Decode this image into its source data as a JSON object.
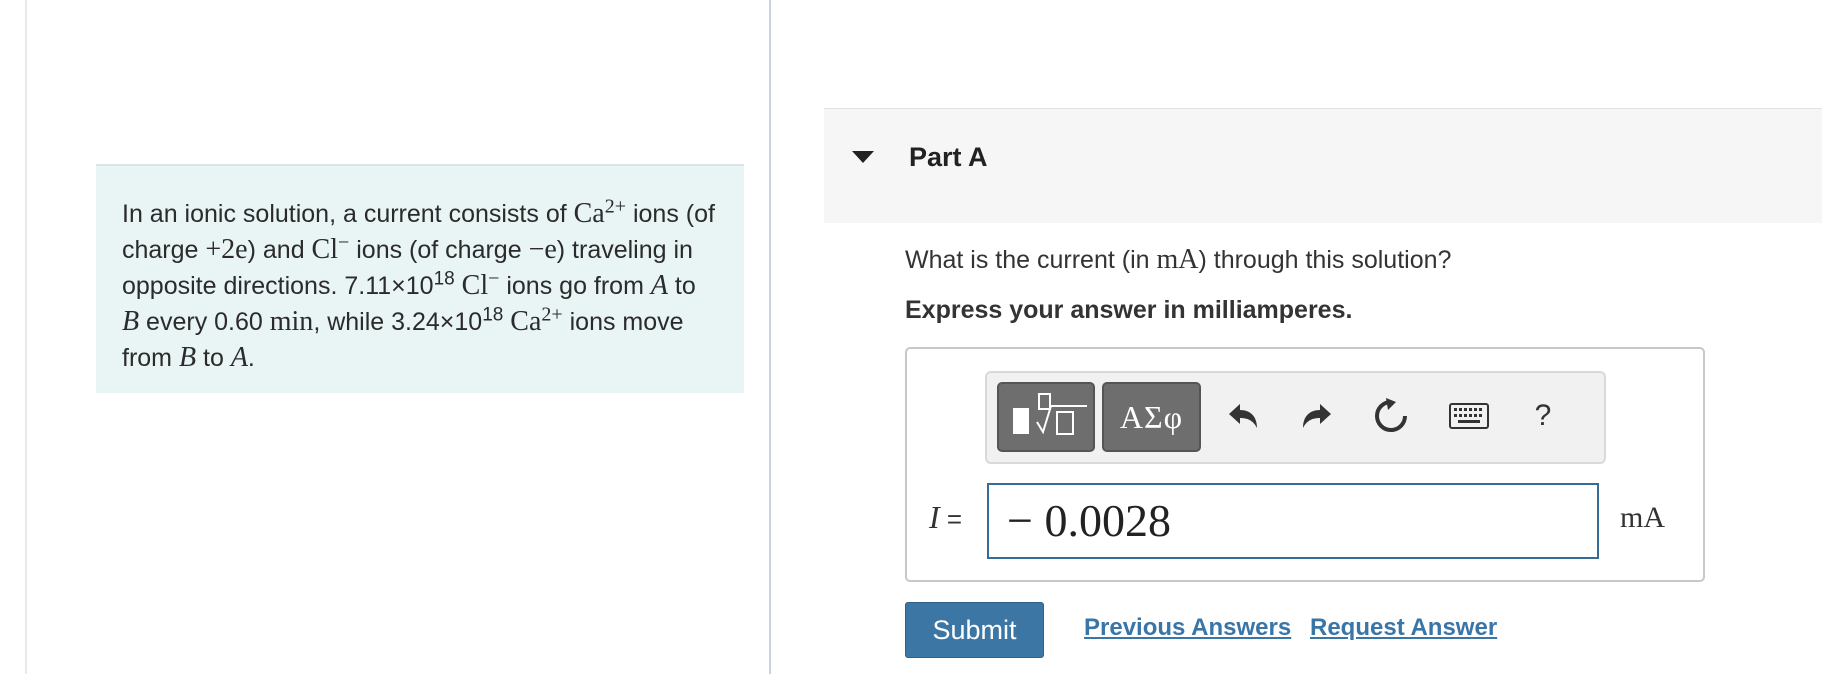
{
  "problem": {
    "t1": "In an ionic solution, a current consists of ",
    "ca": "Ca",
    "ca_sup": "2+",
    "t2": " ions (of charge ",
    "charge1": "+2e",
    "t3": ") and ",
    "cl": "Cl",
    "cl_sup": "−",
    "t4": " ions (of charge ",
    "charge2": "−e",
    "t5": ") traveling in opposite directions. 7.11×10",
    "exp1": "18",
    "t6": " ",
    "cl2": "Cl",
    "cl2_sup": "−",
    "t7": " ions go from ",
    "pA": "A",
    "t8": " to ",
    "pB": "B",
    "t9": " every 0.60 ",
    "unit_min": "min",
    "t10": ", while 3.24×10",
    "exp2": "18",
    "t11": " ",
    "ca2": "Ca",
    "ca2_sup": "2+",
    "t12": " ions move from ",
    "pB2": "B",
    "t13": " to ",
    "pA2": "A",
    "t14": "."
  },
  "part": {
    "title": "Part A"
  },
  "question": {
    "pre": "What is the current (in ",
    "unit": "mA",
    "post": ") through this solution?"
  },
  "instruction": "Express your answer in milliamperes.",
  "toolbar": {
    "greek_label": "ΑΣφ",
    "help_label": "?"
  },
  "answer": {
    "variable": "I",
    "equals": " =",
    "value": "− 0.0028",
    "unit": "mA"
  },
  "actions": {
    "submit": "Submit",
    "previous_answers": "Previous Answers",
    "request_answer": "Request Answer"
  },
  "colors": {
    "submit_bg": "#3c76a4",
    "link": "#3a75a8",
    "problem_bg": "#e9f4f4",
    "input_border": "#356d98"
  }
}
